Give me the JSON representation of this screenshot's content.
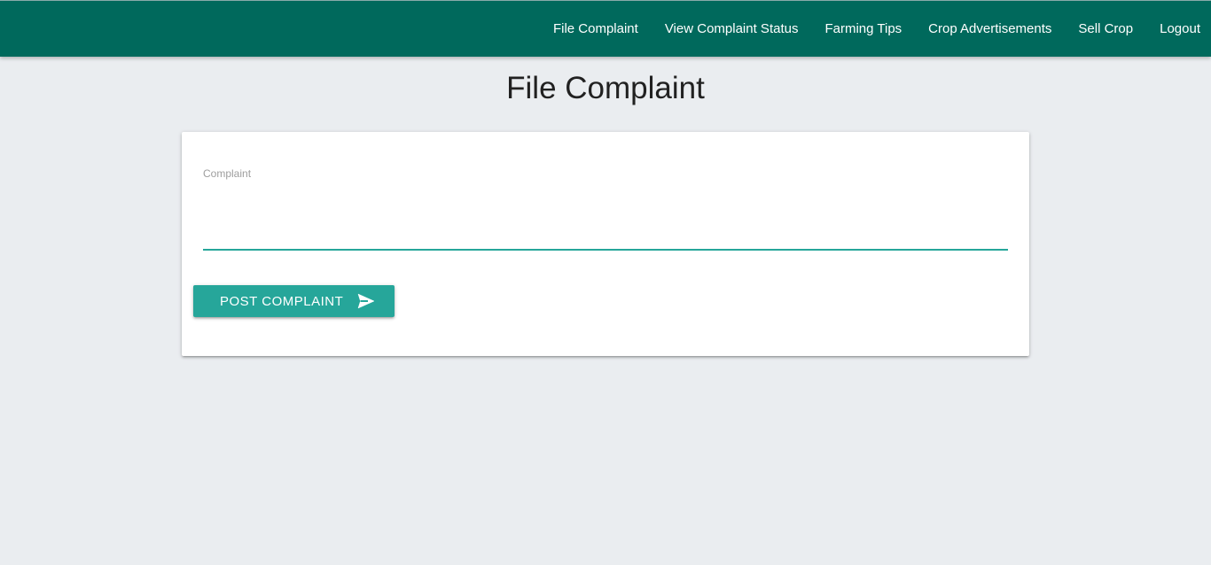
{
  "nav": {
    "items": [
      {
        "label": "File Complaint"
      },
      {
        "label": "View Complaint Status"
      },
      {
        "label": "Farming Tips"
      },
      {
        "label": "Crop Advertisements"
      },
      {
        "label": "Sell Crop"
      },
      {
        "label": "Logout"
      }
    ]
  },
  "page": {
    "title": "File Complaint"
  },
  "form": {
    "complaint_label": "Complaint",
    "complaint_value": "",
    "submit_label": "POST COMPLAINT",
    "submit_icon": "send-icon"
  },
  "colors": {
    "navbar": "#00695c",
    "accent": "#26a69a",
    "background": "#eaedf0"
  }
}
